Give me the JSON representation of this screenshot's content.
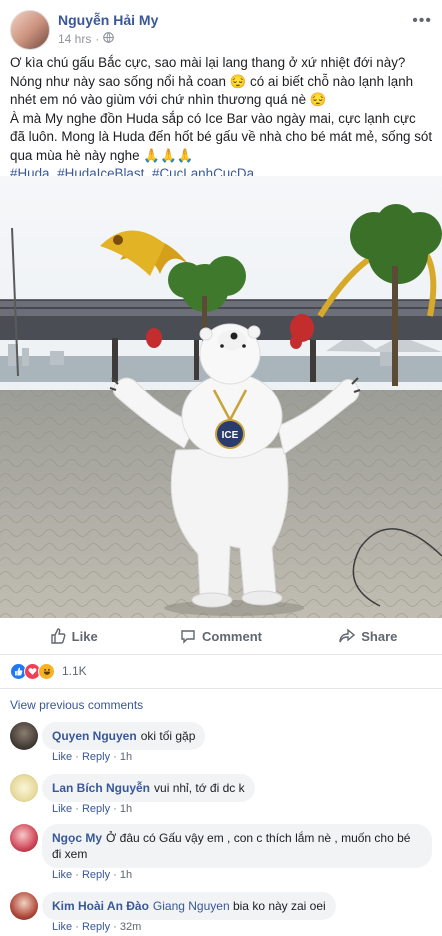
{
  "post": {
    "author": "Nguyễn Hải My",
    "time": "14 hrs",
    "more": "•••",
    "text_lines": [
      "Ơ kìa chú gấu Bắc cực, sao mài lại lang thang ở xứ nhiệt đới này? Nóng như này sao sống nổi hả coan 😔 có ai biết chỗ nào lạnh lạnh nhét em nó vào giùm với chứ nhìn thương quá nè 😔",
      "À mà My nghe đồn Huda sắp có Ice Bar vào ngày mai, cực lạnh cực đã luôn. Mong là Huda đến hốt bé gấu về nhà cho bé mát mẻ, sống sót qua mùa hè này nghe 🙏🙏🙏"
    ],
    "hashtags": [
      "#Huda",
      "#HudaIceBlast",
      "#CucLanhCucDa"
    ],
    "medal_text": "ICE"
  },
  "actions": {
    "like": "Like",
    "comment": "Comment",
    "share": "Share"
  },
  "reactions": {
    "count": "1.1K"
  },
  "view_previous": "View previous comments",
  "comment_actions": {
    "like": "Like",
    "reply": "Reply",
    "sep": "·"
  },
  "comments": [
    {
      "name": "Quyen Nguyen",
      "text": "oki tối gặp",
      "time": "1h"
    },
    {
      "name": "Lan Bích Nguyễn",
      "text": "vui nhỉ, tớ đi dc k",
      "time": "1h"
    },
    {
      "name": "Ngọc My",
      "text": "Ở đâu có Gấu vậy em , con c thích lắm nè , muốn cho bé đi xem",
      "time": "1h"
    },
    {
      "name": "Kim Hoài An Đào",
      "mention": "Giang Nguyen",
      "text": "bia ko này zai oei",
      "time": "32m"
    }
  ],
  "colors": {
    "link": "#385898",
    "meta": "#90949c",
    "bubble": "#f2f3f5"
  }
}
